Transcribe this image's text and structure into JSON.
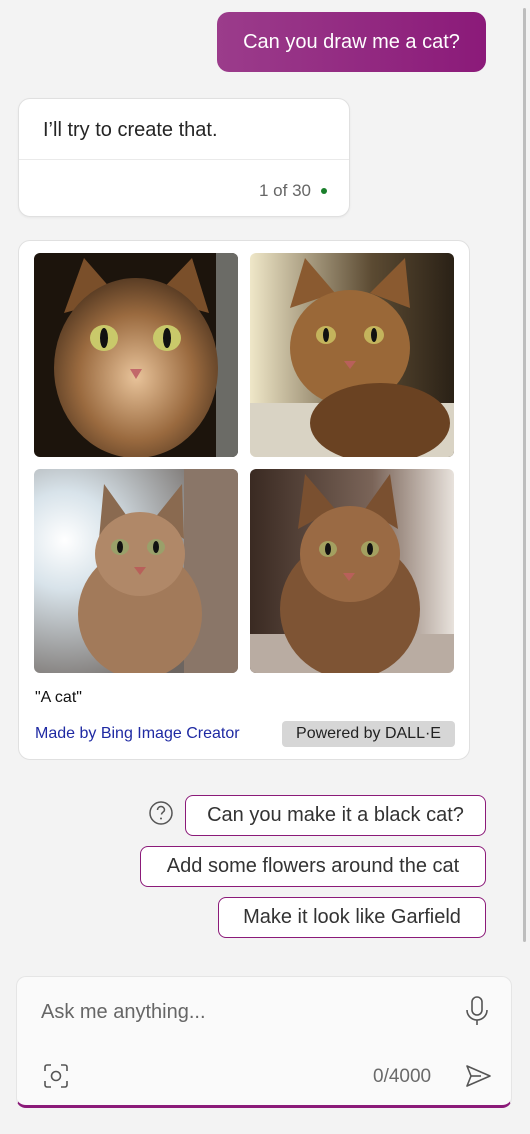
{
  "chat": {
    "user_message": "Can you draw me a cat?",
    "bot_message": "I’ll try to create that.",
    "turn_count": "1 of 30"
  },
  "image_result": {
    "images": [
      {
        "alt": "cat image 1"
      },
      {
        "alt": "cat image 2"
      },
      {
        "alt": "cat image 3"
      },
      {
        "alt": "cat image 4"
      }
    ],
    "caption": "\"A cat\"",
    "made_by": "Made by Bing Image Creator",
    "powered_by": "Powered by DALL·E"
  },
  "suggestions": [
    "Can you make it a black cat?",
    "Add some flowers around the cat",
    "Make it look like Garfield"
  ],
  "composer": {
    "placeholder": "Ask me anything...",
    "char_count": "0/4000"
  },
  "colors": {
    "accent": "#8b1a79",
    "status_dot": "#1a7f2b",
    "link": "#1f2aa3"
  }
}
